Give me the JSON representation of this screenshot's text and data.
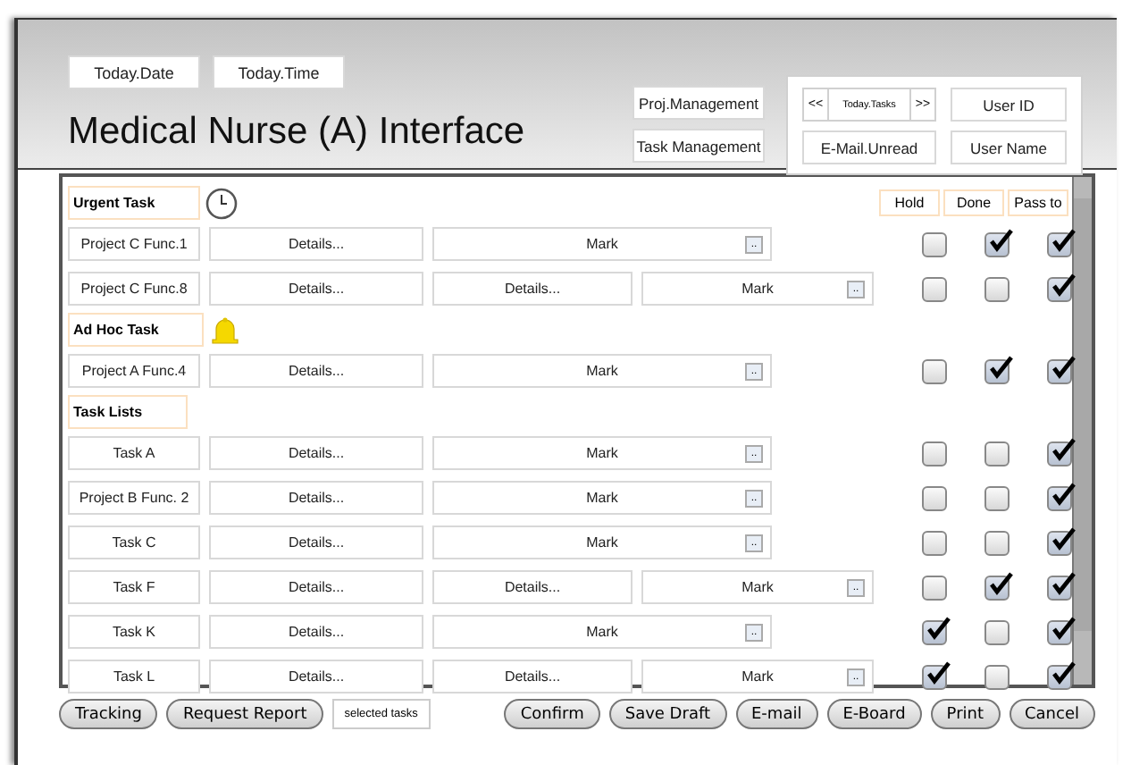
{
  "header": {
    "date": "Today.Date",
    "time": "Today.Time",
    "title": "Medical Nurse (A) Interface",
    "nav_buttons": [
      "Proj.Management",
      "Task Management"
    ],
    "tasks_prev": "<<",
    "tasks_label": "Today.Tasks",
    "tasks_next": ">>",
    "user_id": "User ID",
    "email_unread": "E-Mail.Unread",
    "user_name": "User Name"
  },
  "columns": [
    "Hold",
    "Done",
    "Pass to"
  ],
  "sections": [
    {
      "title": "Urgent Task",
      "kind": "urgent",
      "rows": [
        {
          "name": "Project C Func.1",
          "details": [
            "Details..."
          ],
          "mark": "Mark",
          "mark_button": "..",
          "hold": false,
          "done": true,
          "pass_to": true
        },
        {
          "name": "Project C Func.8",
          "details": [
            "Details...",
            "Details..."
          ],
          "mark": "Mark",
          "mark_button": "..",
          "hold": false,
          "done": false,
          "pass_to": true
        }
      ]
    },
    {
      "title": "Ad Hoc Task",
      "kind": "adhoc",
      "rows": [
        {
          "name": "Project A Func.4",
          "details": [
            "Details..."
          ],
          "mark": "Mark",
          "mark_button": "..",
          "hold": false,
          "done": true,
          "pass_to": true
        }
      ]
    },
    {
      "title": "Task Lists",
      "kind": "list",
      "rows": [
        {
          "name": "Task A",
          "details": [
            "Details..."
          ],
          "mark": "Mark",
          "mark_button": "..",
          "hold": false,
          "done": false,
          "pass_to": true
        },
        {
          "name": "Project B Func. 2",
          "details": [
            "Details..."
          ],
          "mark": "Mark",
          "mark_button": "..",
          "hold": false,
          "done": false,
          "pass_to": true
        },
        {
          "name": "Task C",
          "details": [
            "Details..."
          ],
          "mark": "Mark",
          "mark_button": "..",
          "hold": false,
          "done": false,
          "pass_to": true
        },
        {
          "name": "Task F",
          "details": [
            "Details...",
            "Details..."
          ],
          "mark": "Mark",
          "mark_button": "..",
          "hold": false,
          "done": true,
          "pass_to": true
        },
        {
          "name": "Task K",
          "details": [
            "Details..."
          ],
          "mark": "Mark",
          "mark_button": "..",
          "hold": true,
          "done": false,
          "pass_to": true
        },
        {
          "name": "Task L",
          "details": [
            "Details...",
            "Details..."
          ],
          "mark": "Mark",
          "mark_button": "..",
          "hold": true,
          "done": false,
          "pass_to": true
        }
      ]
    }
  ],
  "footer": {
    "left_buttons": [
      "Tracking",
      "Request Report"
    ],
    "selected_field": "selected tasks",
    "right_buttons": [
      "Confirm",
      "Save Draft",
      "E-mail",
      "E-Board",
      "Print",
      "Cancel"
    ]
  }
}
